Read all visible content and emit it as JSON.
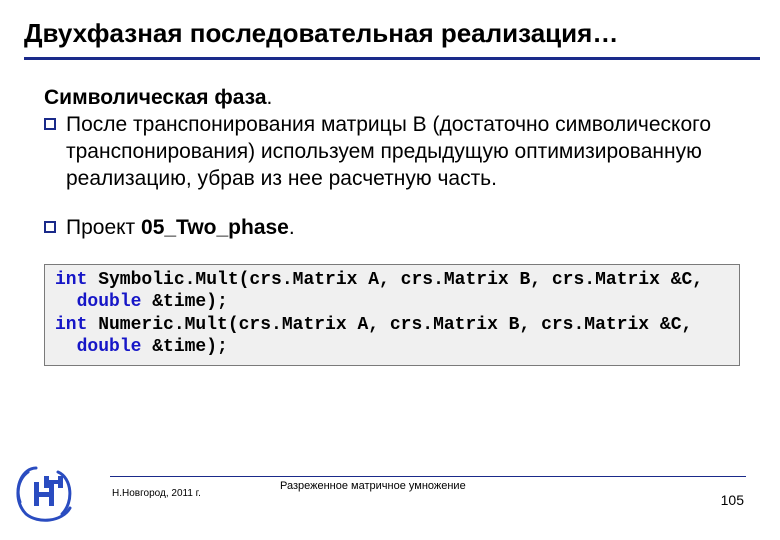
{
  "title": "Двухфазная последовательная реализация…",
  "subhead": "Символическая фаза",
  "bullets": [
    "После транспонирования матрицы B (достаточно символического транспонирования) используем предыдущую оптимизированную реализацию, убрав из нее расчетную часть.",
    "Проект "
  ],
  "project_name": "05_Two_phase",
  "code": {
    "l1a": "int",
    "l1b": " Symbolic.Mult(crs.Matrix A, crs.Matrix B, crs.Matrix &C,",
    "l2a": "double",
    "l2b": " &time);",
    "l3a": "int",
    "l3b": " Numeric.Mult(crs.Matrix A, crs.Matrix B, crs.Matrix &C,",
    "l4a": "double",
    "l4b": " &time);"
  },
  "footer": {
    "location": "Н.Новгород, 2011 г.",
    "center": "Разреженное матричное умножение",
    "page": "105"
  },
  "colors": {
    "accent": "#1a2a8a",
    "keyword": "#1616c7"
  }
}
